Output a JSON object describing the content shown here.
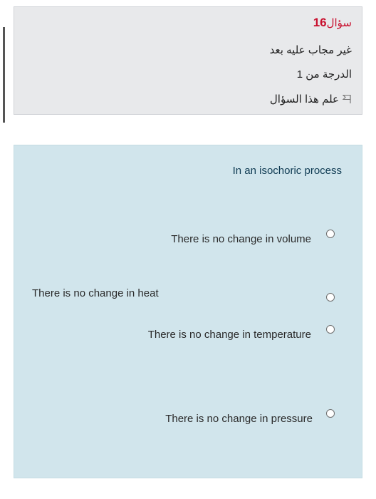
{
  "info": {
    "question_word": "سؤال",
    "question_number": "16",
    "status": "غير مجاب عليه بعد",
    "grade": "الدرجة من 1",
    "flag_label": "علم هذا السؤال",
    "flag_icon": "flag-icon"
  },
  "question": {
    "text": "In an isochoric process",
    "options": [
      {
        "label": "There is no change in volume"
      },
      {
        "label": "There is no change in heat"
      },
      {
        "label": "There is no change in temperature"
      },
      {
        "label": "There is no change in pressure"
      }
    ]
  },
  "colors": {
    "accent_red": "#c8102e",
    "info_bg": "#e8e9eb",
    "question_bg": "#d1e5ec",
    "question_text": "#0e3a52"
  }
}
